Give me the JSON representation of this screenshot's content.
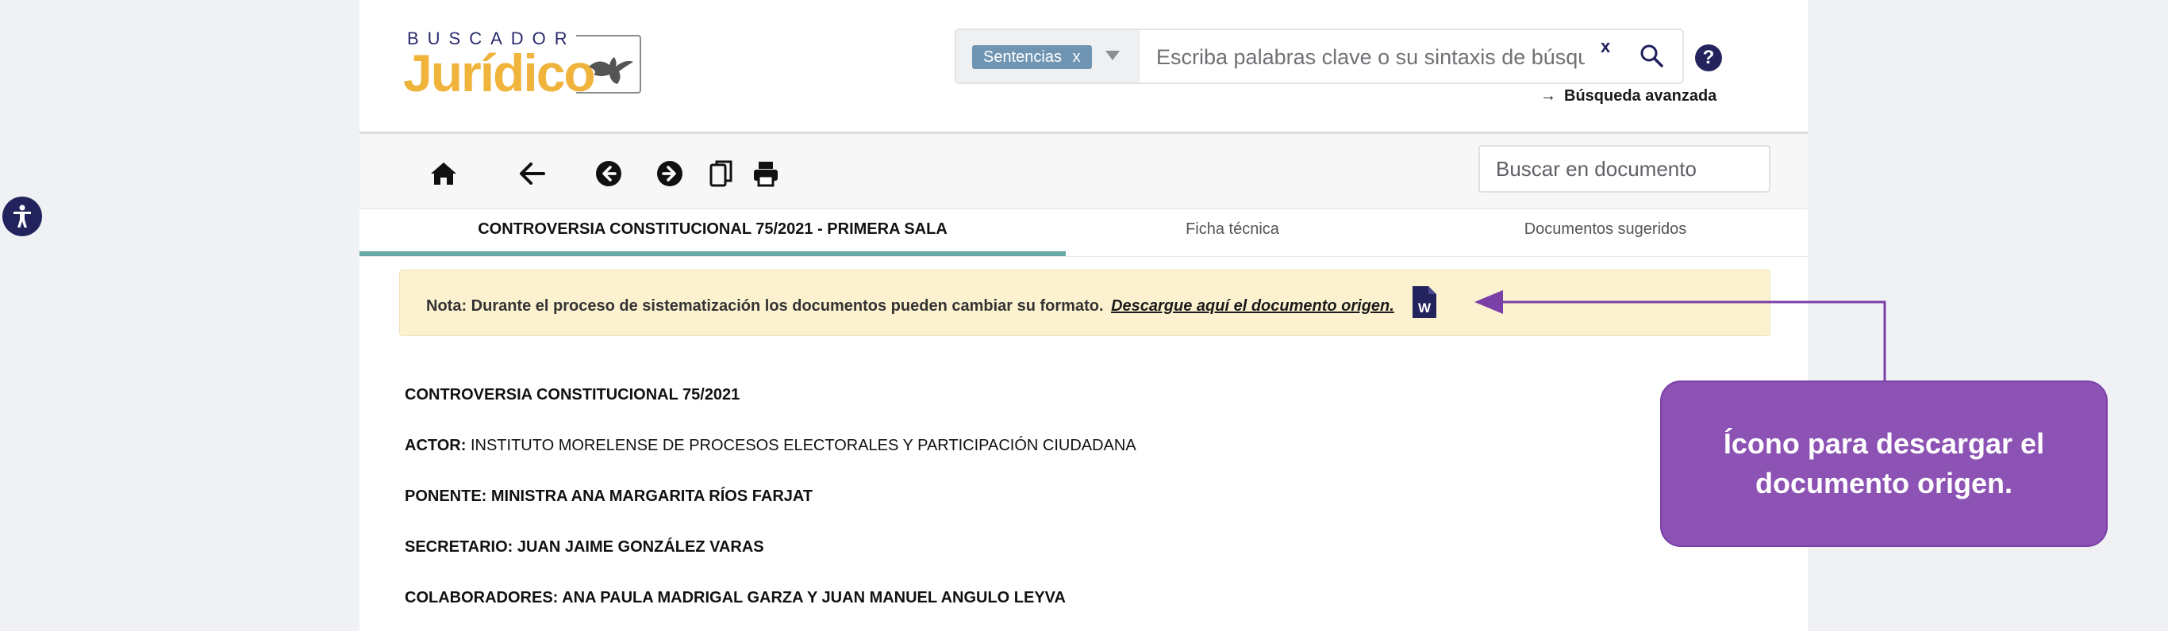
{
  "header": {
    "logo_top": "BUSCADOR",
    "logo_main": "Jurídico",
    "filter_chip": "Sentencias",
    "filter_chip_remove": "x",
    "search_placeholder": "Escriba palabras clave o su sintaxis de búsqueda",
    "search_clear": "x",
    "help": "?",
    "advanced_arrow": "→",
    "advanced_label": "Búsqueda avanzada"
  },
  "toolbar": {
    "doc_search_placeholder": "Buscar en documento",
    "icons": [
      "home-icon",
      "back-arrow-icon",
      "previous-circle-icon",
      "next-circle-icon",
      "copy-icon",
      "print-icon"
    ]
  },
  "tabs": [
    {
      "label": "CONTROVERSIA CONSTITUCIONAL 75/2021 - PRIMERA SALA",
      "active": true
    },
    {
      "label": "Ficha técnica",
      "active": false
    },
    {
      "label": "Documentos sugeridos",
      "active": false
    }
  ],
  "note": {
    "text": "Nota: Durante el proceso de sistematización los documentos pueden cambiar su formato.",
    "link": "Descargue aquí el documento origen.",
    "icon_letter": "W"
  },
  "document": {
    "title": "CONTROVERSIA CONSTITUCIONAL 75/2021",
    "actor_label": "ACTOR:",
    "actor_value": "INSTITUTO MORELENSE DE PROCESOS ELECTORALES Y PARTICIPACIÓN CIUDADANA",
    "ponente": "PONENTE: MINISTRA ANA MARGARITA RÍOS FARJAT",
    "secretario": "SECRETARIO: JUAN JAIME GONZÁLEZ VARAS",
    "colaboradores": "COLABORADORES: ANA PAULA MADRIGAL GARZA Y JUAN MANUEL ANGULO LEYVA"
  },
  "callout": {
    "text": "Ícono para descargar el documento origen."
  },
  "colors": {
    "accent_purple": "#8c52b4",
    "navy": "#22235d",
    "logo_gold": "#f0b43c",
    "note_bg": "#fdf2d0",
    "tab_underline": "#69a9a5",
    "chip": "#6f95b3"
  }
}
